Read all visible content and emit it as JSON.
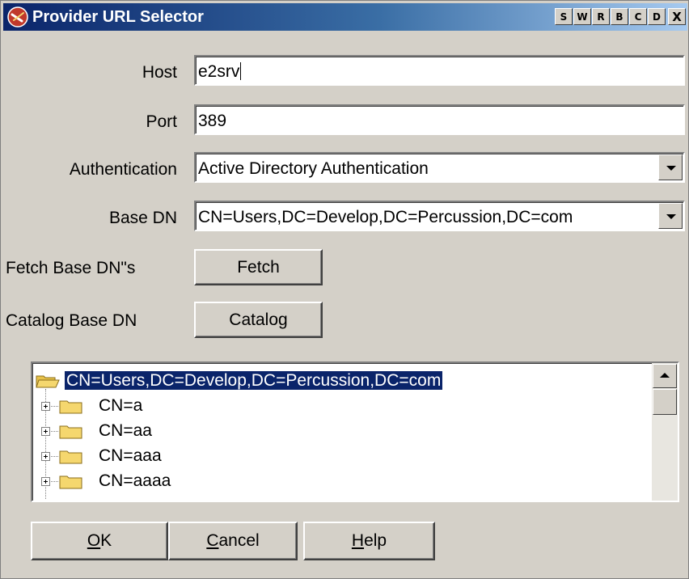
{
  "window": {
    "title": "Provider URL Selector",
    "titlebar_buttons": [
      "S",
      "W",
      "R",
      "B",
      "C",
      "D",
      "X"
    ],
    "app_icon": "no-entry-icon"
  },
  "form": {
    "host": {
      "label": "Host",
      "value": "e2srv"
    },
    "port": {
      "label": "Port",
      "value": "389"
    },
    "authentication": {
      "label": "Authentication",
      "value": "Active Directory Authentication"
    },
    "base_dn": {
      "label": "Base DN",
      "value": "CN=Users,DC=Develop,DC=Percussion,DC=com"
    },
    "fetch": {
      "label": "Fetch Base DN\"s",
      "button": "Fetch"
    },
    "catalog": {
      "label": "Catalog Base DN",
      "button": "Catalog"
    }
  },
  "tree": {
    "root": "CN=Users,DC=Develop,DC=Percussion,DC=com",
    "children": [
      "CN=a",
      "CN=aa",
      "CN=aaa",
      "CN=aaaa"
    ],
    "folder_color": "#f5d76e",
    "selection_color": "#0a246a"
  },
  "footer": {
    "ok_prefix": "",
    "ok_mnemonic": "O",
    "ok_rest": "K",
    "cancel_mnemonic": "C",
    "cancel_rest": "ancel",
    "help_mnemonic": "H",
    "help_rest": "elp"
  }
}
